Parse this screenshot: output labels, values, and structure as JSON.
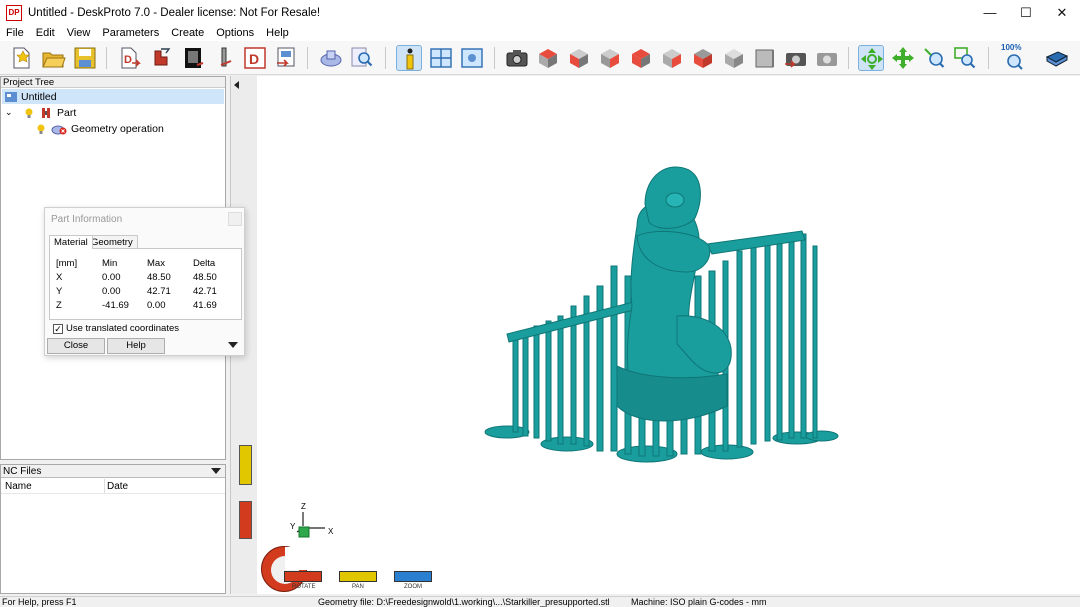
{
  "window": {
    "logo_text": "DP",
    "title": "Untitled - DeskProto 7.0 - Dealer license: Not For Resale!",
    "minimize_glyph": "—",
    "maximize_glyph": "☐",
    "close_glyph": "✕"
  },
  "menu": {
    "file": "File",
    "edit": "Edit",
    "view": "View",
    "parameters": "Parameters",
    "create": "Create",
    "options": "Options",
    "help": "Help"
  },
  "toolbar": {
    "zoom_percent": "100%",
    "icons": [
      "new-file-icon",
      "open-folder-icon",
      "save-icon",
      "import-geometry-icon",
      "part-icon",
      "bitmap-icon",
      "vector-icon",
      "dxf-icon",
      "export-icon",
      "operation-icon",
      "search-icon",
      "info-icon",
      "window-icon",
      "view-window-icon",
      "camera-icon",
      "view-top-icon",
      "view-front-icon",
      "view-left-icon",
      "view-right-icon",
      "view-back-icon",
      "view-bottom-icon",
      "view-iso-icon",
      "view-iso2-icon",
      "render-icon",
      "render2-icon",
      "rotate-view-icon",
      "pan-view-icon",
      "zoom-in-icon",
      "zoom-window-icon",
      "zoom-100-icon",
      "book-help-icon"
    ]
  },
  "project_tree": {
    "header": "Project Tree",
    "root": "Untitled",
    "part": "Part",
    "operation": "Geometry operation"
  },
  "nc_files": {
    "header": "NC Files",
    "col_name": "Name",
    "col_date": "Date"
  },
  "part_info": {
    "title": "Part Information",
    "tab_material": "Material",
    "tab_geometry": "Geometry",
    "unit": "[mm]",
    "col_min": "Min",
    "col_max": "Max",
    "col_delta": "Delta",
    "rows": [
      {
        "axis": "X",
        "min": "0.00",
        "max": "48.50",
        "delta": "48.50"
      },
      {
        "axis": "Y",
        "min": "0.00",
        "max": "42.71",
        "delta": "42.71"
      },
      {
        "axis": "Z",
        "min": "-41.69",
        "max": "0.00",
        "delta": "41.69"
      }
    ],
    "checkbox_label": "Use translated coordinates",
    "checkbox_checked": true,
    "close_label": "Close",
    "help_label": "Help"
  },
  "axis_triad": {
    "z": "Z",
    "y": "Y",
    "x": "X"
  },
  "nav_controls": {
    "rotate": "ROTATE",
    "pan": "PAN",
    "zoom": "ZOOM"
  },
  "statusbar": {
    "help_hint": "For Help, press F1",
    "geometry_file": "Geometry file: D:\\Freedesignwold\\1.working\\...\\Starkiller_presupported.stl",
    "machine": "Machine: ISO plain G-codes - mm"
  },
  "colors": {
    "model": "#1a9d9d",
    "model_dark": "#0f7676",
    "selection": "#cfe5fa",
    "rotate": "#d23b1e",
    "pan": "#e0c700",
    "zoom": "#2b7fd0"
  }
}
